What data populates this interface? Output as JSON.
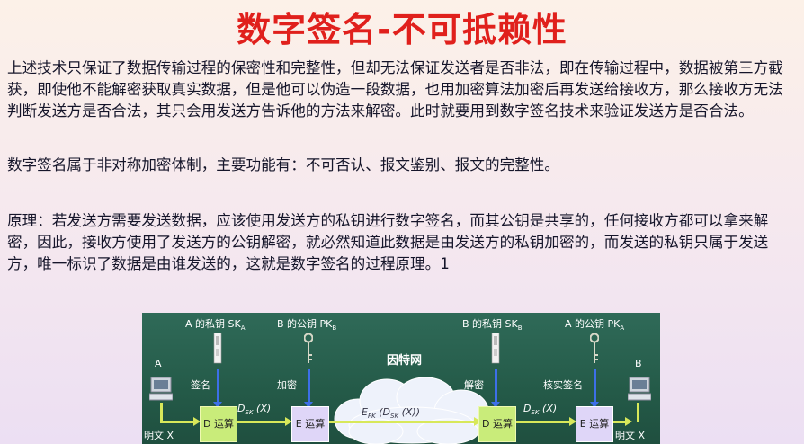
{
  "title": "数字签名-不可抵赖性",
  "paragraphs": [
    "上述技术只保证了数据传输过程的保密性和完整性，但却无法保证发送者是否非法，即在传输过程中，数据被第三方截获，即使他不能解密获取真实数据，但是他可以伪造一段数据，也用加密算法加密后再发送给接收方，那么接收方无法判断发送方是否合法，其只会用发送方告诉他的方法来解密。此时就要用到数字签名技术来验证发送方是否合法。",
    "数字签名属于非对称加密体制，主要功能有：不可否认、报文鉴别、报文的完整性。",
    "原理：若发送方需要发送数据，应该使用发送方的私钥进行数字签名，而其公钥是共享的，任何接收方都可以拿来解密，因此，接收方使用了发送方的公钥解密，就必然知道此数据是由发送方的私钥加密的，而发送的私钥只属于发送方，唯一标识了数据是由谁发送的，这就是数字签名的过程原理。1"
  ],
  "diagram": {
    "key_labels": {
      "a_private": "A 的私钥 SK",
      "a_private_sub": "A",
      "b_public": "B 的公钥 PK",
      "b_public_sub": "B",
      "b_private": "B 的私钥 SK",
      "b_private_sub": "B",
      "a_public": "A 的公钥 PK",
      "a_public_sub": "A"
    },
    "sender": "A",
    "receiver": "B",
    "internet": "因特网",
    "steps": {
      "sign": "签名",
      "encrypt": "加密",
      "decrypt": "解密",
      "verify": "核实签名"
    },
    "boxes": {
      "d1": "D 运算",
      "e1": "E 运算",
      "d2": "D 运算",
      "e2": "E 运算"
    },
    "formulas": {
      "sig1": "D",
      "sig1_sub": "SK",
      "sig1_tail": "(X)",
      "cipher": "E",
      "cipher_sub": "PK",
      "cipher_mid": "(D",
      "cipher_sub2": "SK",
      "cipher_tail": "(X))",
      "sig2": "D",
      "sig2_sub": "SK",
      "sig2_tail": "(X)"
    },
    "plaintext_left": "明文 X",
    "plaintext_right": "明文 X"
  },
  "colors": {
    "title": "#e0201c",
    "diagram_bg": "#2a6150",
    "d_box": "#c9ec7a",
    "e_box": "#dfd6f8",
    "arrow_blue": "#3d6fe8",
    "arrow_yellow": "#d8e85a"
  }
}
